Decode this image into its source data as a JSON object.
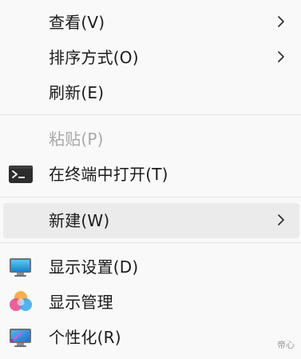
{
  "menu": {
    "items": [
      {
        "label": "查看(V)",
        "submenu": true
      },
      {
        "label": "排序方式(O)",
        "submenu": true
      },
      {
        "label": "刷新(E)"
      },
      {
        "label": "粘贴(P)",
        "disabled": true
      },
      {
        "label": "在终端中打开(T)",
        "icon": "terminal-icon"
      },
      {
        "label": "新建(W)",
        "submenu": true,
        "highlighted": true
      },
      {
        "label": "显示设置(D)",
        "icon": "display-settings-icon"
      },
      {
        "label": "显示管理",
        "icon": "display-management-icon"
      },
      {
        "label": "个性化(R)",
        "icon": "personalize-icon"
      }
    ]
  },
  "watermark": "帝心",
  "colors": {
    "background": "#f9f9f9",
    "hover": "#ebebeb",
    "separator": "#e5e5e5",
    "text": "#1b1b1b",
    "disabled_text": "#a8a8a8"
  }
}
